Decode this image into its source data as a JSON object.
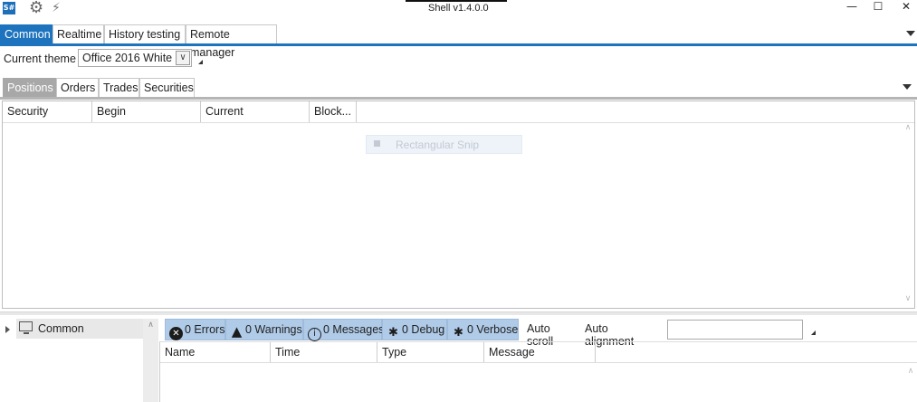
{
  "window": {
    "title": "Shell v1.4.0.0",
    "logo_text": "S#",
    "minimize_glyph": "—",
    "maximize_glyph": "☐",
    "close_glyph": "✕"
  },
  "toolbar_icons": [
    "settings-gear",
    "plug-disconnected"
  ],
  "main_tabs": [
    {
      "label": "Common",
      "active": true
    },
    {
      "label": "Realtime",
      "active": false
    },
    {
      "label": "History testing",
      "active": false
    },
    {
      "label": "Remote manager",
      "active": false
    }
  ],
  "theme": {
    "label": "Current theme",
    "value": "Office 2016 White"
  },
  "sub_tabs": [
    {
      "label": "Positions",
      "active": true
    },
    {
      "label": "Orders",
      "active": false
    },
    {
      "label": "Trades",
      "active": false
    },
    {
      "label": "Securities",
      "active": false
    }
  ],
  "positions_grid": {
    "columns": [
      "Security",
      "Begin",
      "Current",
      "Block..."
    ],
    "rows": []
  },
  "overlay": {
    "snip_label": "Rectangular Snip"
  },
  "tree": {
    "items": [
      {
        "label": "Common",
        "icon": "monitor"
      }
    ]
  },
  "log_filters": [
    {
      "label": "0 Errors",
      "icon": "error"
    },
    {
      "label": "0 Warnings",
      "icon": "warning"
    },
    {
      "label": "0 Messages",
      "icon": "info"
    },
    {
      "label": "0 Debug",
      "icon": "bug"
    },
    {
      "label": "0 Verbose",
      "icon": "bug"
    }
  ],
  "log_options": {
    "auto_scroll": "Auto scroll",
    "auto_alignment": "Auto alignment",
    "filter_value": ""
  },
  "log_grid": {
    "columns": [
      "Name",
      "Time",
      "Type",
      "Message"
    ],
    "rows": []
  },
  "colors": {
    "accent": "#1e73be",
    "filter_button": "#b0cbe8",
    "subtab_active": "#a8a8a8"
  }
}
